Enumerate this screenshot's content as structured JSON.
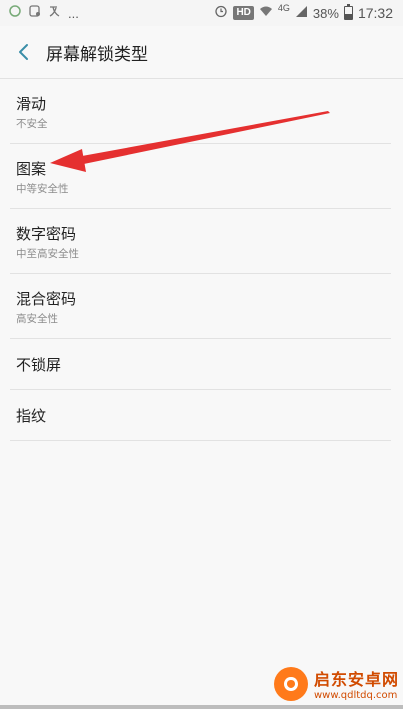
{
  "status_bar": {
    "left_icons": [
      "notification-app-icon",
      "message-icon",
      "translate-icon"
    ],
    "overflow": "...",
    "hd": "HD",
    "network": "4G",
    "battery": "38%",
    "time": "17:32"
  },
  "header": {
    "title": "屏幕解锁类型"
  },
  "options": [
    {
      "label": "滑动",
      "sub": "不安全"
    },
    {
      "label": "图案",
      "sub": "中等安全性"
    },
    {
      "label": "数字密码",
      "sub": "中至高安全性"
    },
    {
      "label": "混合密码",
      "sub": "高安全性"
    },
    {
      "label": "不锁屏"
    },
    {
      "label": "指纹"
    }
  ],
  "annotation": {
    "color": "#e53030"
  },
  "watermark": {
    "name": "启东安卓网",
    "url": "www.qdltdq.com"
  }
}
